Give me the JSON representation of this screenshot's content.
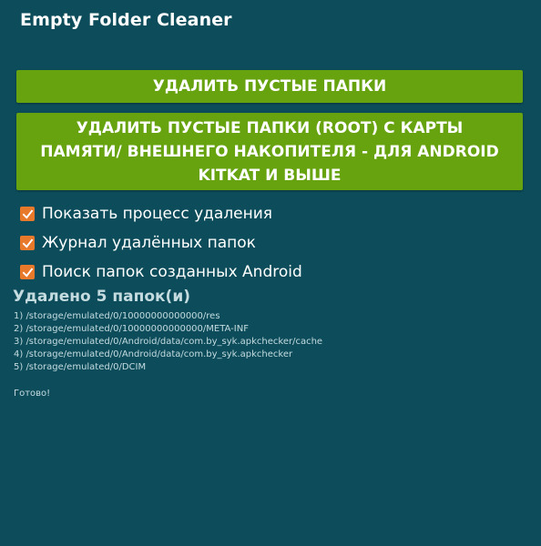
{
  "app": {
    "title": "Empty Folder Cleaner"
  },
  "buttons": {
    "delete_empty": "УДАЛИТЬ ПУСТЫЕ ПАПКИ",
    "delete_empty_root": "УДАЛИТЬ ПУСТЫЕ ПАПКИ (ROOT) С КАРТЫ ПАМЯТИ/ ВНЕШНЕГО НАКОПИТЕЛЯ - ДЛЯ ANDROID KITKAT И ВЫШЕ"
  },
  "options": [
    {
      "label": "Показать процесс удаления",
      "checked": true
    },
    {
      "label": "Журнал удалённых папок",
      "checked": true
    },
    {
      "label": "Поиск папок созданных Android",
      "checked": true
    }
  ],
  "result": {
    "heading": "Удалено 5 папок(и)",
    "log": [
      "1) /storage/emulated/0/10000000000000/res",
      "2) /storage/emulated/0/10000000000000/META-INF",
      "3) /storage/emulated/0/Android/data/com.by_syk.apkchecker/cache",
      "4) /storage/emulated/0/Android/data/com.by_syk.apkchecker",
      "5) /storage/emulated/0/DCIM"
    ],
    "status": "Готово!"
  },
  "colors": {
    "background": "#0d4d5b",
    "button": "#66a30f",
    "checkbox": "#e8782a",
    "muted_text": "#c4dbe0"
  },
  "icons": {
    "checkbox": "check-icon"
  }
}
